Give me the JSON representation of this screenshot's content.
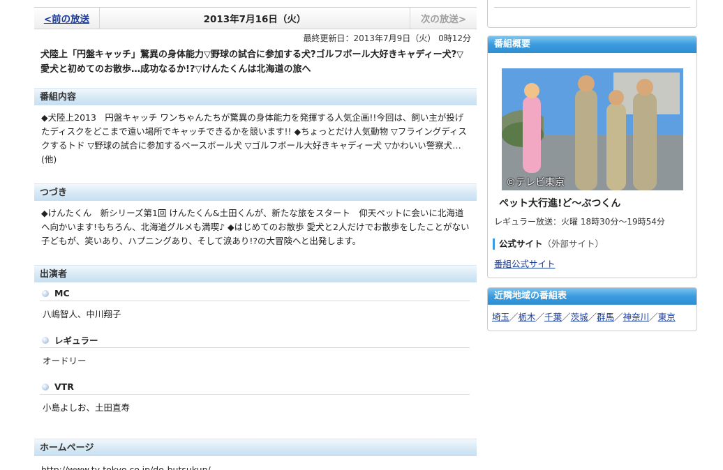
{
  "nav": {
    "prev_label": "<前の放送",
    "date": "2013年7月16日（火）",
    "next_label": "次の放送>"
  },
  "updated": "最終更新日：2013年7月9日（火） 0時12分",
  "program_title": "犬陸上「円盤キャッチ」驚異の身体能力▽野球の試合に参加する犬?ゴルフボール大好きキャディー犬?▽愛犬と初めてのお散歩…成功なるか!?▽けんたくんは北海道の旅へ",
  "sections": {
    "content": {
      "heading": "番組内容",
      "body": "◆犬陸上2013　円盤キャッチ ワンちゃんたちが驚異の身体能力を発揮する人気企画!!今回は、飼い主が投げたディスクをどこまで遠い場所でキャッチできるかを競います!! ◆ちょっとだけ人気動物 ▽フライングディスクするトド ▽野球の試合に参加するベースボール犬 ▽ゴルフボール大好きキャディー犬 ▽かわいい警察犬…(他)"
    },
    "next": {
      "heading": "つづき",
      "body": "◆けんたくん　新シリーズ第1回 けんたくん&土田くんが、新たな旅をスタート　仰天ペットに会いに北海道へ向かいます!もちろん、北海道グルメも満喫♪ ◆はじめてのお散歩 愛犬と2人だけでお散歩をしたことがない子どもが、笑いあり、ハプニングあり、そして涙あり!?の大冒険へと出発します。"
    },
    "cast": {
      "heading": "出演者",
      "roles": [
        {
          "role": "MC",
          "names": "八嶋智人、中川翔子"
        },
        {
          "role": "レギュラー",
          "names": "オードリー"
        },
        {
          "role": "VTR",
          "names": "小島よしお、土田直寿"
        }
      ]
    },
    "homepage": {
      "heading": "ホームページ",
      "url": "http://www.tv-tokyo.co.jp/do-butsukun/"
    }
  },
  "sidebar": {
    "overview": {
      "heading": "番組概要",
      "photo_credit": "©テレビ東京",
      "show_name": "ペット大行進!ど～ぶつくん",
      "regular": "レギュラー放送：火曜 18時30分～19時54分",
      "official_label": "公式サイト",
      "official_ext": "（外部サイト）",
      "official_link": "番組公式サイト"
    },
    "regions": {
      "heading": "近隣地域の番組表",
      "items": [
        "埼玉",
        "栃木",
        "千葉",
        "茨城",
        "群馬",
        "神奈川",
        "東京"
      ],
      "separator": "／"
    }
  },
  "colors": {
    "link": "#1a3c9e",
    "side_header": "#3a9bdd",
    "section_header": "#d6e8f5"
  }
}
